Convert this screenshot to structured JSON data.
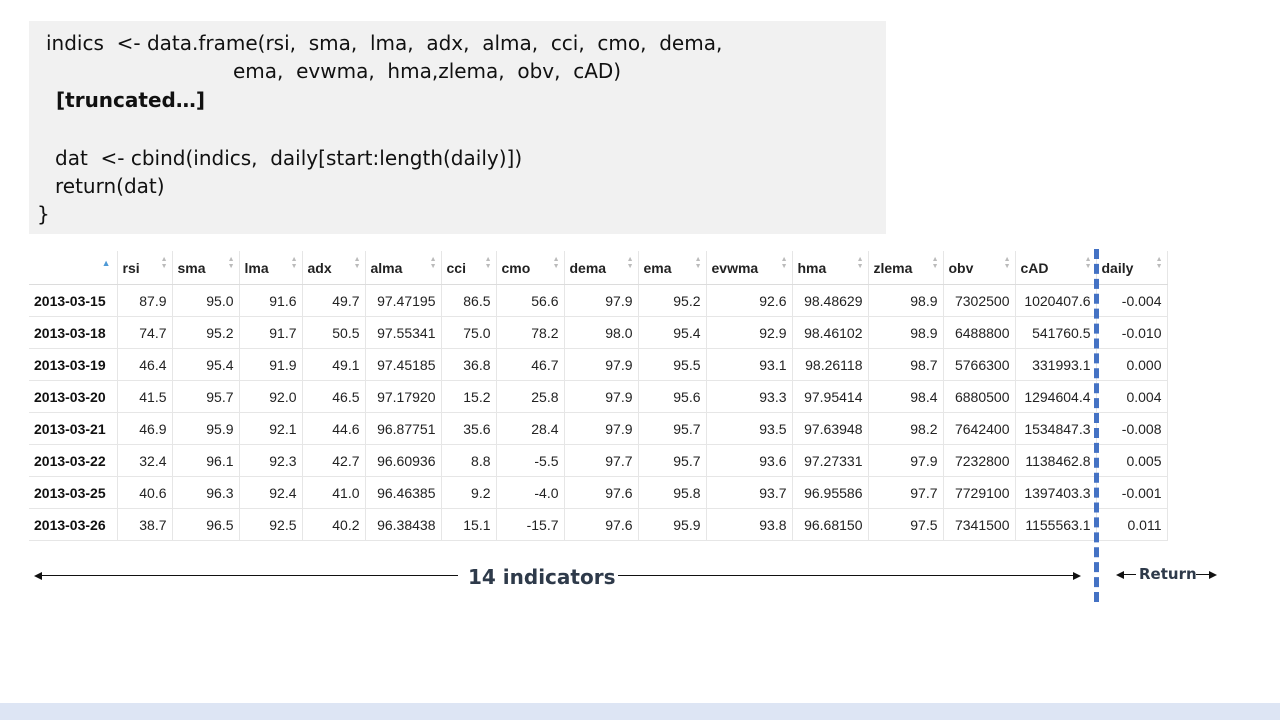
{
  "code": {
    "lines": [
      {
        "text": "indics  <- data.frame(rsi,  sma,  lma,  adx,  alma,  cci,  cmo,  dema,",
        "bold": false
      },
      {
        "text": "ema,  evwma,  hma,zlema,  obv,  cAD)",
        "bold": false
      },
      {
        "text": "[truncated…]",
        "bold": true
      },
      {
        "text": "dat  <- cbind(indics,  daily[start:length(daily)])",
        "bold": false
      },
      {
        "text": "return(dat)",
        "bold": false
      },
      {
        "text": "}",
        "bold": false
      }
    ]
  },
  "table": {
    "columns": [
      "",
      "rsi",
      "sma",
      "lma",
      "adx",
      "alma",
      "cci",
      "cmo",
      "dema",
      "ema",
      "evwma",
      "hma",
      "zlema",
      "obv",
      "cAD",
      "daily"
    ],
    "rows": [
      [
        "2013-03-15",
        "87.9",
        "95.0",
        "91.6",
        "49.7",
        "97.47195",
        "86.5",
        "56.6",
        "97.9",
        "95.2",
        "92.6",
        "98.48629",
        "98.9",
        "7302500",
        "1020407.6",
        "-0.004"
      ],
      [
        "2013-03-18",
        "74.7",
        "95.2",
        "91.7",
        "50.5",
        "97.55341",
        "75.0",
        "78.2",
        "98.0",
        "95.4",
        "92.9",
        "98.46102",
        "98.9",
        "6488800",
        "541760.5",
        "-0.010"
      ],
      [
        "2013-03-19",
        "46.4",
        "95.4",
        "91.9",
        "49.1",
        "97.45185",
        "36.8",
        "46.7",
        "97.9",
        "95.5",
        "93.1",
        "98.26118",
        "98.7",
        "5766300",
        "331993.1",
        "0.000"
      ],
      [
        "2013-03-20",
        "41.5",
        "95.7",
        "92.0",
        "46.5",
        "97.17920",
        "15.2",
        "25.8",
        "97.9",
        "95.6",
        "93.3",
        "97.95414",
        "98.4",
        "6880500",
        "1294604.4",
        "0.004"
      ],
      [
        "2013-03-21",
        "46.9",
        "95.9",
        "92.1",
        "44.6",
        "96.87751",
        "35.6",
        "28.4",
        "97.9",
        "95.7",
        "93.5",
        "97.63948",
        "98.2",
        "7642400",
        "1534847.3",
        "-0.008"
      ],
      [
        "2013-03-22",
        "32.4",
        "96.1",
        "92.3",
        "42.7",
        "96.60936",
        "8.8",
        "-5.5",
        "97.7",
        "95.7",
        "93.6",
        "97.27331",
        "97.9",
        "7232800",
        "1138462.8",
        "0.005"
      ],
      [
        "2013-03-25",
        "40.6",
        "96.3",
        "92.4",
        "41.0",
        "96.46385",
        "9.2",
        "-4.0",
        "97.6",
        "95.8",
        "93.7",
        "96.95586",
        "97.7",
        "7729100",
        "1397403.3",
        "-0.001"
      ],
      [
        "2013-03-26",
        "38.7",
        "96.5",
        "92.5",
        "40.2",
        "96.38438",
        "15.1",
        "-15.7",
        "97.6",
        "95.9",
        "93.8",
        "96.68150",
        "97.5",
        "7341500",
        "1155563.1",
        "0.011"
      ]
    ]
  },
  "annotations": {
    "indicators_label": "14  indicators",
    "return_label": "Return"
  },
  "colors": {
    "divider": "#4472c4",
    "footer_bar": "#dde5f4",
    "code_bg": "#f1f1f1",
    "sort_active": "#4f9ad6"
  }
}
